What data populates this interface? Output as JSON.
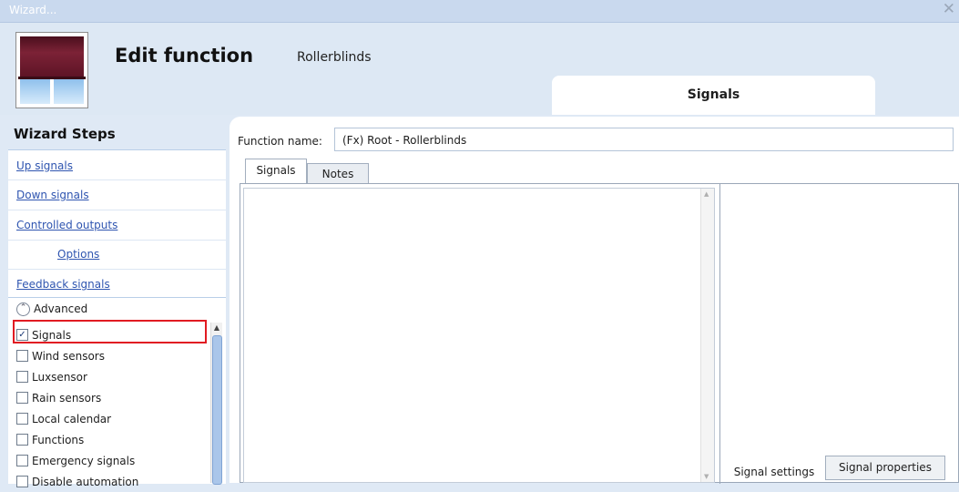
{
  "window": {
    "title": "Wizard...",
    "close_glyph": "✕"
  },
  "header": {
    "icon": "rollerblind-icon",
    "title": "Edit function",
    "subtitle": "Rollerblinds",
    "tab_label": "Signals"
  },
  "wizard": {
    "title": "Wizard Steps",
    "steps": [
      {
        "label": "Up signals"
      },
      {
        "label": "Down signals"
      },
      {
        "label": "Controlled outputs"
      },
      {
        "label": "Options"
      },
      {
        "label": "Feedback signals"
      }
    ],
    "advanced": {
      "label": "Advanced",
      "items": [
        {
          "label": "Signals",
          "checked": true
        },
        {
          "label": "Wind sensors",
          "checked": false
        },
        {
          "label": "Luxsensor",
          "checked": false
        },
        {
          "label": "Rain sensors",
          "checked": false
        },
        {
          "label": "Local calendar",
          "checked": false
        },
        {
          "label": "Functions",
          "checked": false
        },
        {
          "label": "Emergency signals",
          "checked": false
        },
        {
          "label": "Disable automation",
          "checked": false
        }
      ]
    }
  },
  "main": {
    "function_name_label": "Function name:",
    "function_name_value": "(Fx) Root - Rollerblinds",
    "tabs": [
      {
        "label": "Signals",
        "active": true
      },
      {
        "label": "Notes",
        "active": false
      }
    ],
    "signal_tabs": [
      {
        "label": "Signal settings",
        "active": true
      },
      {
        "label": "Signal properties",
        "active": false
      }
    ]
  },
  "colors": {
    "accent": "#2f55b0",
    "highlight": "#e11b22",
    "background": "#dfe9f5"
  }
}
